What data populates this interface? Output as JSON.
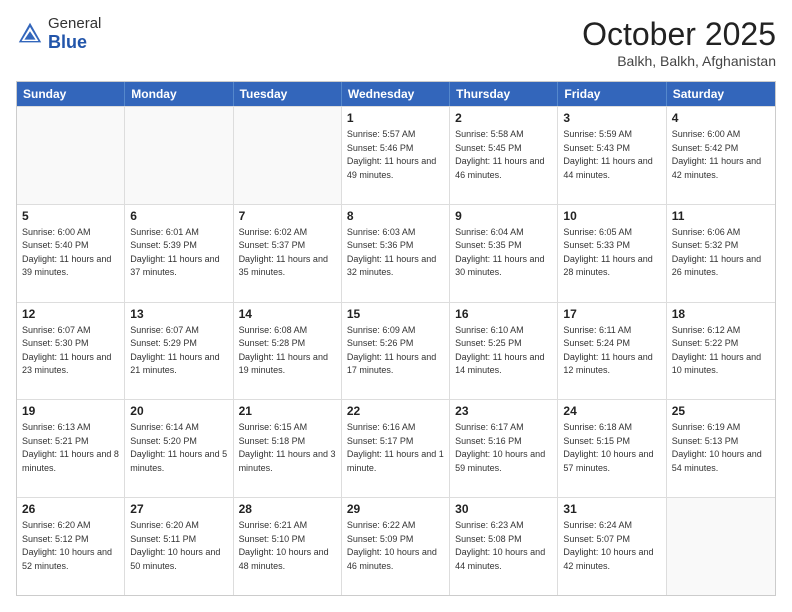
{
  "header": {
    "logo_general": "General",
    "logo_blue": "Blue",
    "month_title": "October 2025",
    "location": "Balkh, Balkh, Afghanistan"
  },
  "days_of_week": [
    "Sunday",
    "Monday",
    "Tuesday",
    "Wednesday",
    "Thursday",
    "Friday",
    "Saturday"
  ],
  "rows": [
    [
      {
        "day": "",
        "empty": true
      },
      {
        "day": "",
        "empty": true
      },
      {
        "day": "",
        "empty": true
      },
      {
        "day": "1",
        "sunrise": "Sunrise: 5:57 AM",
        "sunset": "Sunset: 5:46 PM",
        "daylight": "Daylight: 11 hours and 49 minutes."
      },
      {
        "day": "2",
        "sunrise": "Sunrise: 5:58 AM",
        "sunset": "Sunset: 5:45 PM",
        "daylight": "Daylight: 11 hours and 46 minutes."
      },
      {
        "day": "3",
        "sunrise": "Sunrise: 5:59 AM",
        "sunset": "Sunset: 5:43 PM",
        "daylight": "Daylight: 11 hours and 44 minutes."
      },
      {
        "day": "4",
        "sunrise": "Sunrise: 6:00 AM",
        "sunset": "Sunset: 5:42 PM",
        "daylight": "Daylight: 11 hours and 42 minutes."
      }
    ],
    [
      {
        "day": "5",
        "sunrise": "Sunrise: 6:00 AM",
        "sunset": "Sunset: 5:40 PM",
        "daylight": "Daylight: 11 hours and 39 minutes."
      },
      {
        "day": "6",
        "sunrise": "Sunrise: 6:01 AM",
        "sunset": "Sunset: 5:39 PM",
        "daylight": "Daylight: 11 hours and 37 minutes."
      },
      {
        "day": "7",
        "sunrise": "Sunrise: 6:02 AM",
        "sunset": "Sunset: 5:37 PM",
        "daylight": "Daylight: 11 hours and 35 minutes."
      },
      {
        "day": "8",
        "sunrise": "Sunrise: 6:03 AM",
        "sunset": "Sunset: 5:36 PM",
        "daylight": "Daylight: 11 hours and 32 minutes."
      },
      {
        "day": "9",
        "sunrise": "Sunrise: 6:04 AM",
        "sunset": "Sunset: 5:35 PM",
        "daylight": "Daylight: 11 hours and 30 minutes."
      },
      {
        "day": "10",
        "sunrise": "Sunrise: 6:05 AM",
        "sunset": "Sunset: 5:33 PM",
        "daylight": "Daylight: 11 hours and 28 minutes."
      },
      {
        "day": "11",
        "sunrise": "Sunrise: 6:06 AM",
        "sunset": "Sunset: 5:32 PM",
        "daylight": "Daylight: 11 hours and 26 minutes."
      }
    ],
    [
      {
        "day": "12",
        "sunrise": "Sunrise: 6:07 AM",
        "sunset": "Sunset: 5:30 PM",
        "daylight": "Daylight: 11 hours and 23 minutes."
      },
      {
        "day": "13",
        "sunrise": "Sunrise: 6:07 AM",
        "sunset": "Sunset: 5:29 PM",
        "daylight": "Daylight: 11 hours and 21 minutes."
      },
      {
        "day": "14",
        "sunrise": "Sunrise: 6:08 AM",
        "sunset": "Sunset: 5:28 PM",
        "daylight": "Daylight: 11 hours and 19 minutes."
      },
      {
        "day": "15",
        "sunrise": "Sunrise: 6:09 AM",
        "sunset": "Sunset: 5:26 PM",
        "daylight": "Daylight: 11 hours and 17 minutes."
      },
      {
        "day": "16",
        "sunrise": "Sunrise: 6:10 AM",
        "sunset": "Sunset: 5:25 PM",
        "daylight": "Daylight: 11 hours and 14 minutes."
      },
      {
        "day": "17",
        "sunrise": "Sunrise: 6:11 AM",
        "sunset": "Sunset: 5:24 PM",
        "daylight": "Daylight: 11 hours and 12 minutes."
      },
      {
        "day": "18",
        "sunrise": "Sunrise: 6:12 AM",
        "sunset": "Sunset: 5:22 PM",
        "daylight": "Daylight: 11 hours and 10 minutes."
      }
    ],
    [
      {
        "day": "19",
        "sunrise": "Sunrise: 6:13 AM",
        "sunset": "Sunset: 5:21 PM",
        "daylight": "Daylight: 11 hours and 8 minutes."
      },
      {
        "day": "20",
        "sunrise": "Sunrise: 6:14 AM",
        "sunset": "Sunset: 5:20 PM",
        "daylight": "Daylight: 11 hours and 5 minutes."
      },
      {
        "day": "21",
        "sunrise": "Sunrise: 6:15 AM",
        "sunset": "Sunset: 5:18 PM",
        "daylight": "Daylight: 11 hours and 3 minutes."
      },
      {
        "day": "22",
        "sunrise": "Sunrise: 6:16 AM",
        "sunset": "Sunset: 5:17 PM",
        "daylight": "Daylight: 11 hours and 1 minute."
      },
      {
        "day": "23",
        "sunrise": "Sunrise: 6:17 AM",
        "sunset": "Sunset: 5:16 PM",
        "daylight": "Daylight: 10 hours and 59 minutes."
      },
      {
        "day": "24",
        "sunrise": "Sunrise: 6:18 AM",
        "sunset": "Sunset: 5:15 PM",
        "daylight": "Daylight: 10 hours and 57 minutes."
      },
      {
        "day": "25",
        "sunrise": "Sunrise: 6:19 AM",
        "sunset": "Sunset: 5:13 PM",
        "daylight": "Daylight: 10 hours and 54 minutes."
      }
    ],
    [
      {
        "day": "26",
        "sunrise": "Sunrise: 6:20 AM",
        "sunset": "Sunset: 5:12 PM",
        "daylight": "Daylight: 10 hours and 52 minutes."
      },
      {
        "day": "27",
        "sunrise": "Sunrise: 6:20 AM",
        "sunset": "Sunset: 5:11 PM",
        "daylight": "Daylight: 10 hours and 50 minutes."
      },
      {
        "day": "28",
        "sunrise": "Sunrise: 6:21 AM",
        "sunset": "Sunset: 5:10 PM",
        "daylight": "Daylight: 10 hours and 48 minutes."
      },
      {
        "day": "29",
        "sunrise": "Sunrise: 6:22 AM",
        "sunset": "Sunset: 5:09 PM",
        "daylight": "Daylight: 10 hours and 46 minutes."
      },
      {
        "day": "30",
        "sunrise": "Sunrise: 6:23 AM",
        "sunset": "Sunset: 5:08 PM",
        "daylight": "Daylight: 10 hours and 44 minutes."
      },
      {
        "day": "31",
        "sunrise": "Sunrise: 6:24 AM",
        "sunset": "Sunset: 5:07 PM",
        "daylight": "Daylight: 10 hours and 42 minutes."
      },
      {
        "day": "",
        "empty": true
      }
    ]
  ]
}
